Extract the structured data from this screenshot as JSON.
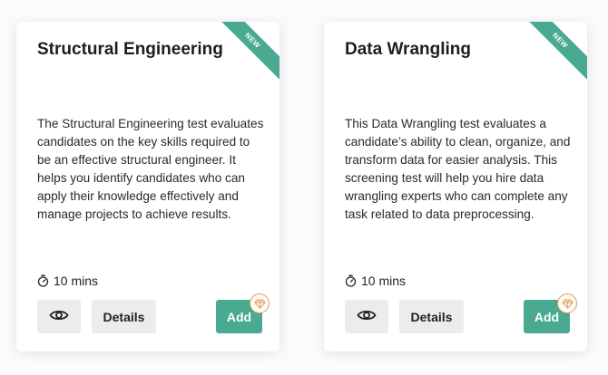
{
  "cards": [
    {
      "badge": "NEW",
      "title": "Structural Engineering",
      "description": "The Structural Engineering test evaluates candidates on the key skills required to be an effective structural engineer. It helps you identify candidates who can apply their knowledge effectively and manage projects to achieve results.",
      "duration": "10 mins",
      "details_label": "Details",
      "add_label": "Add"
    },
    {
      "badge": "NEW",
      "title": "Data Wrangling",
      "description": "This Data Wrangling test evaluates a candidate’s ability to clean, organize, and transform data for easier analysis. This screening test will help you hire data wrangling experts who can complete any task related to data preprocessing.",
      "duration": "10 mins",
      "details_label": "Details",
      "add_label": "Add"
    }
  ],
  "icons": {
    "timer": "timer-icon",
    "preview": "eye-icon",
    "premium": "diamond-icon"
  },
  "colors": {
    "accent": "#4aaa91",
    "button_bg": "#ececec",
    "premium_badge": "#d9a062"
  }
}
